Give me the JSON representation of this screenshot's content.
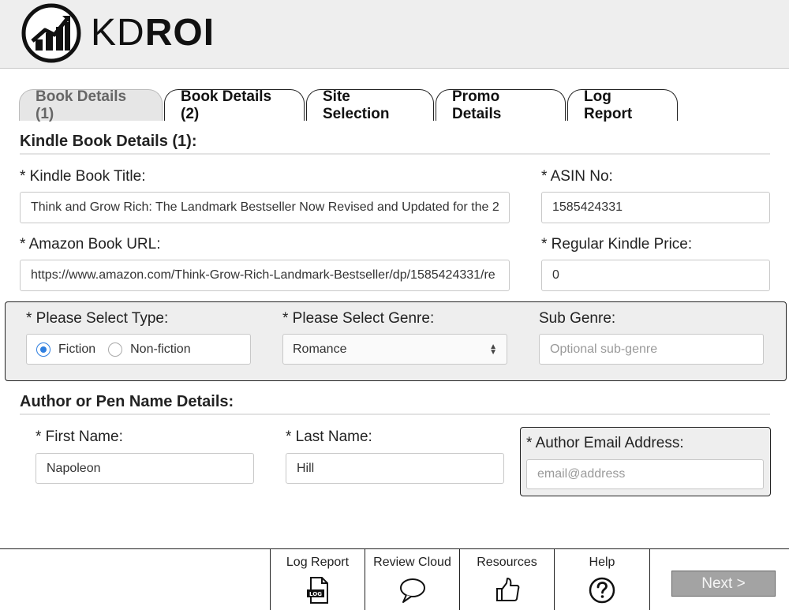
{
  "brand": {
    "kd": "KD",
    "roi": "ROI"
  },
  "tabs": [
    {
      "label": "Book Details (1)",
      "active": true
    },
    {
      "label": "Book Details (2)",
      "active": false
    },
    {
      "label": "Site Selection",
      "active": false
    },
    {
      "label": "Promo Details",
      "active": false
    },
    {
      "label": "Log Report",
      "active": false
    }
  ],
  "kindle_section": {
    "title": "Kindle Book Details (1):",
    "book_title_label": "* Kindle Book Title:",
    "book_title_value": "Think and Grow Rich: The Landmark Bestseller Now Revised and Updated for the 2",
    "asin_label": "* ASIN No:",
    "asin_value": "1585424331",
    "url_label": "* Amazon Book URL:",
    "url_value": "https://www.amazon.com/Think-Grow-Rich-Landmark-Bestseller/dp/1585424331/re",
    "price_label": "* Regular Kindle Price:",
    "price_value": "0"
  },
  "type_section": {
    "type_label": "* Please Select Type:",
    "type_options": [
      "Fiction",
      "Non-fiction"
    ],
    "type_selected": "Fiction",
    "genre_label": "* Please Select Genre:",
    "genre_value": "Romance",
    "subgenre_label": "Sub Genre:",
    "subgenre_placeholder": "Optional sub-genre"
  },
  "author_section": {
    "title": "Author or Pen Name Details:",
    "first_name_label": "* First Name:",
    "first_name_value": "Napoleon",
    "last_name_label": "* Last Name:",
    "last_name_value": "Hill",
    "email_label": "* Author Email Address:",
    "email_placeholder": "email@address"
  },
  "footer": {
    "log_report": "Log Report",
    "log_icon_text": "LOG",
    "review_cloud": "Review Cloud",
    "resources": "Resources",
    "help": "Help",
    "next": "Next >"
  },
  "colors": {
    "radio_accent": "#2f7fe0",
    "header_bg": "#eeeeee",
    "next_bg": "#a3a3a3"
  }
}
